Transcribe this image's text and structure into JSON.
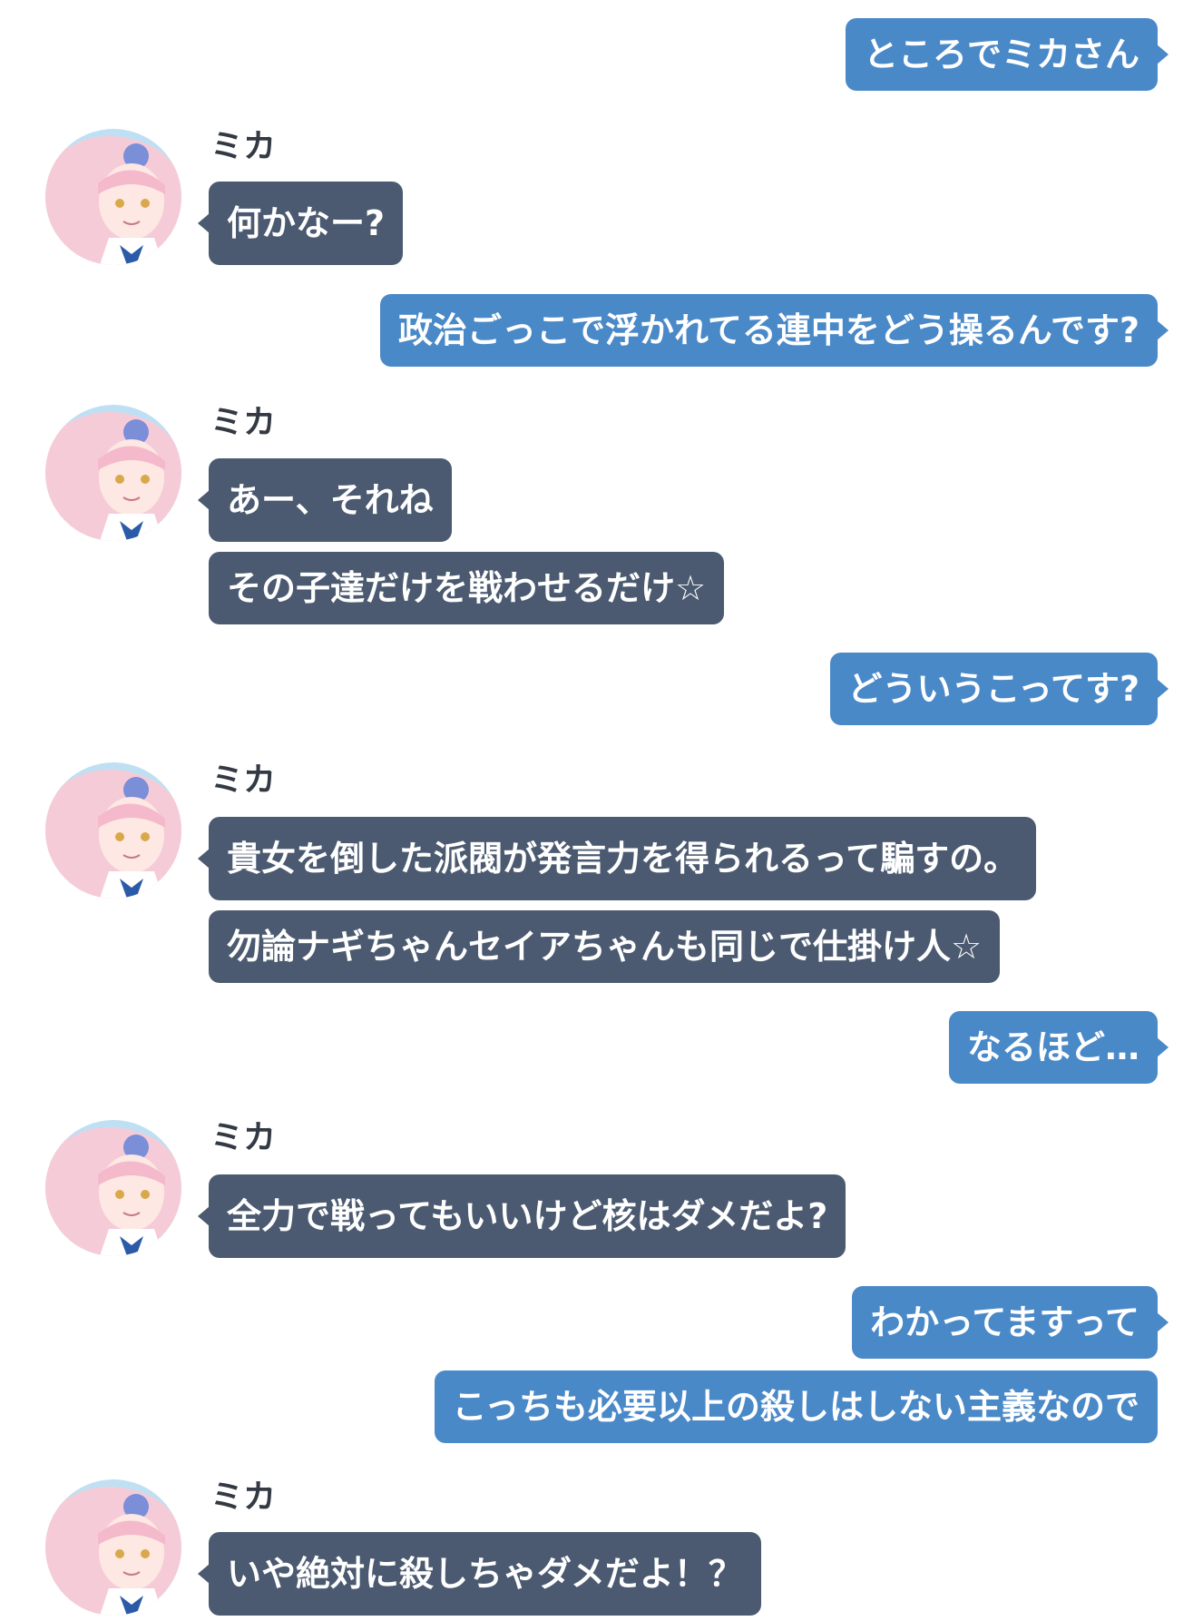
{
  "colors": {
    "outgoing_bubble": "#4a89c8",
    "incoming_bubble": "#4b5a70",
    "sender_name": "#333a44",
    "background": "#ffffff"
  },
  "sender": {
    "name": "ミカ",
    "avatar_icon": "avatar-pink-hair-girl"
  },
  "messages": [
    {
      "side": "out",
      "text": "ところでミカさん"
    },
    {
      "side": "in",
      "sender": "ミカ",
      "lines": [
        "何かなー?"
      ]
    },
    {
      "side": "out",
      "text": "政治ごっこで浮かれてる連中をどう操るんです?"
    },
    {
      "side": "in",
      "sender": "ミカ",
      "lines": [
        "あー、それね",
        "その子達だけを戦わせるだけ☆"
      ]
    },
    {
      "side": "out",
      "text": "どういうこってす?"
    },
    {
      "side": "in",
      "sender": "ミカ",
      "lines": [
        "貴女を倒した派閥が発言力を得られるって騙すの。",
        "勿論ナギちゃんセイアちゃんも同じで仕掛け人☆"
      ]
    },
    {
      "side": "out",
      "text": "なるほど…"
    },
    {
      "side": "in",
      "sender": "ミカ",
      "lines": [
        "全力で戦ってもいいけど核はダメだよ?"
      ]
    },
    {
      "side": "out",
      "text": "わかってますって"
    },
    {
      "side": "out",
      "text": "こっちも必要以上の殺しはしない主義なので"
    },
    {
      "side": "in",
      "sender": "ミカ",
      "lines": [
        "いや絶対に殺しちゃダメだよ！？"
      ]
    }
  ]
}
